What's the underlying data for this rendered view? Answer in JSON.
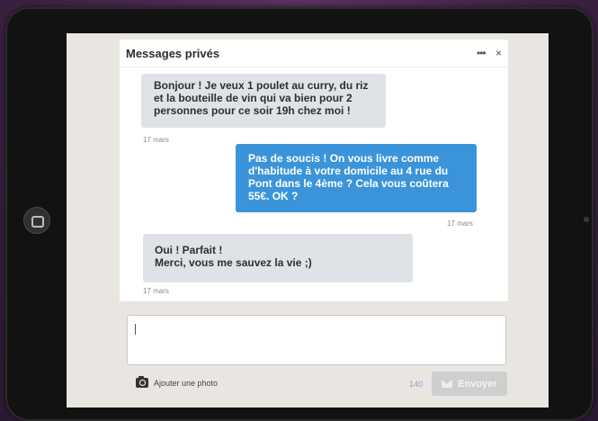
{
  "header": {
    "title": "Messages privés",
    "more_label": "•••",
    "close_label": "×"
  },
  "messages": [
    {
      "direction": "incoming",
      "lines": [
        "Bonjour ! Je veux 1 poulet au curry, du riz",
        "et la bouteille de vin qui va bien pour 2",
        "personnes pour ce soir 19h chez moi !"
      ],
      "time": "17 mars"
    },
    {
      "direction": "outgoing",
      "lines": [
        "Pas de soucis ! On vous livre comme",
        "d'habitude à votre domicile au 4 rue du",
        "Pont dans le 4ème ? Cela vous coûtera",
        "55€. OK ?"
      ],
      "time": "17 mars"
    },
    {
      "direction": "incoming",
      "lines": [
        "Oui ! Parfait !",
        "Merci, vous me sauvez la vie ;)"
      ],
      "time": "17 mars"
    }
  ],
  "composer": {
    "value": "",
    "photo_label": "Ajouter une photo",
    "char_count": "140",
    "send_label": "Envoyer"
  },
  "colors": {
    "accent": "#3b94d9",
    "incoming_bubble": "#dfe3e8",
    "send_disabled": "#cfcfcf"
  },
  "icons": [
    "camera-icon",
    "send-icon",
    "more-icon",
    "close-icon"
  ]
}
